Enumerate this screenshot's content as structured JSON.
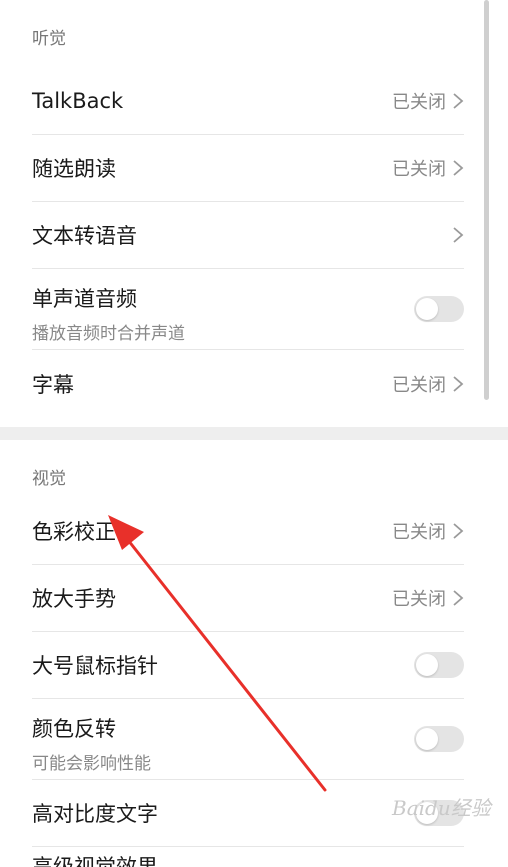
{
  "sections": [
    {
      "header": "听觉",
      "items": [
        {
          "title": "TalkBack",
          "status": "已关闭"
        },
        {
          "title": "随选朗读",
          "status": "已关闭"
        },
        {
          "title": "文本转语音"
        },
        {
          "title": "单声道音频",
          "subtitle": "播放音频时合并声道"
        },
        {
          "title": "字幕",
          "status": "已关闭"
        }
      ]
    },
    {
      "header": "视觉",
      "items": [
        {
          "title": "色彩校正",
          "status": "已关闭"
        },
        {
          "title": "放大手势",
          "status": "已关闭"
        },
        {
          "title": "大号鼠标指针"
        },
        {
          "title": "颜色反转",
          "subtitle": "可能会影响性能"
        },
        {
          "title": "高对比度文字"
        },
        {
          "title": "高级视觉效果"
        }
      ]
    }
  ],
  "toggles": {
    "mono_audio": false,
    "large_pointer": false,
    "color_inversion": false,
    "high_contrast_text": false
  },
  "watermark": "Baidu经验",
  "colors": {
    "annotation_arrow": "#e8302a",
    "toggle_off_track": "#e4e4e4",
    "secondary_text": "#888888"
  }
}
